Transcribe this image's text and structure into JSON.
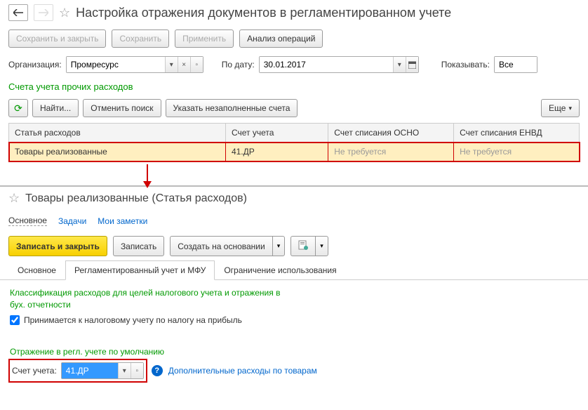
{
  "top_panel": {
    "title": "Настройка отражения документов в регламентированном учете",
    "toolbar": {
      "save_close": "Сохранить и закрыть",
      "save": "Сохранить",
      "apply": "Применить",
      "analysis": "Анализ операций"
    },
    "filter": {
      "org_label": "Организация:",
      "org_value": "Промресурс",
      "date_label": "По дату:",
      "date_value": "30.01.2017",
      "show_label": "Показывать:",
      "show_value": "Все"
    },
    "section": "Счета учета прочих расходов",
    "grid_toolbar": {
      "find": "Найти...",
      "cancel_search": "Отменить поиск",
      "specify_empty": "Указать незаполненные счета",
      "more": "Еще"
    },
    "table": {
      "columns": [
        "Статья расходов",
        "Счет учета",
        "Счет списания ОСНО",
        "Счет списания ЕНВД"
      ],
      "rows": [
        {
          "name": "Товары реализованные",
          "account": "41.ДР",
          "osno": "Не требуется",
          "envd": "Не требуется"
        }
      ]
    }
  },
  "bottom_panel": {
    "title": "Товары реализованные (Статья расходов)",
    "nav": {
      "main": "Основное",
      "tasks": "Задачи",
      "notes": "Мои заметки"
    },
    "toolbar": {
      "save_close": "Записать и закрыть",
      "save": "Записать",
      "create_based": "Создать на основании"
    },
    "tabs": [
      "Основное",
      "Регламентированный учет и МФУ",
      "Ограничение использования"
    ],
    "content": {
      "classification_line1": "Классификация расходов для целей налогового учета и отражения в",
      "classification_line2": "бух. отчетности",
      "checkbox_label": "Принимается к налоговому учету по налогу на прибыль",
      "default_section": "Отражение в регл. учете по умолчанию",
      "account_label": "Счет учета:",
      "account_value": "41.ДР",
      "extra_link": "Дополнительные расходы по товарам"
    }
  }
}
